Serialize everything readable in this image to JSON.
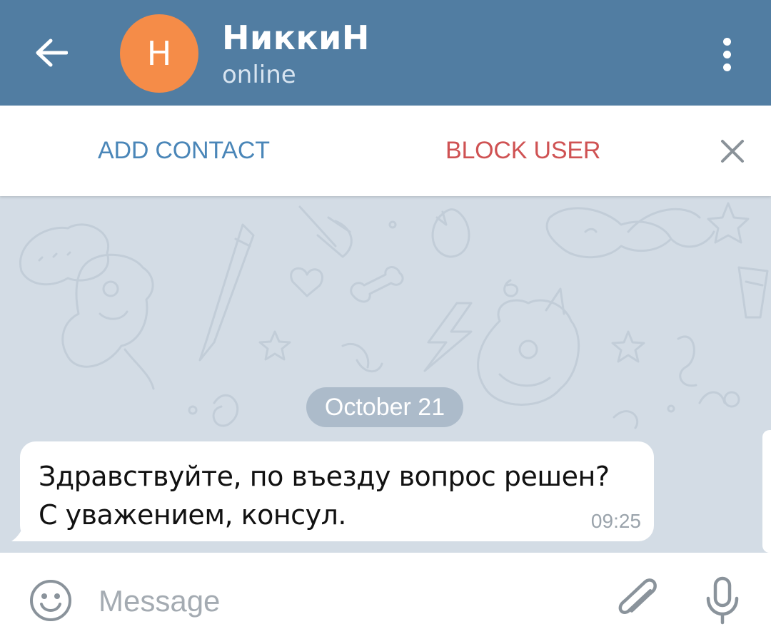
{
  "header": {
    "back_icon": "arrow-left-icon",
    "avatar_letter": "Н",
    "avatar_color": "#f58c48",
    "name": "НиккиН",
    "status": "online",
    "menu_icon": "more-vertical-icon",
    "background_color": "#517da2"
  },
  "action_bar": {
    "add_contact_label": "ADD CONTACT",
    "block_user_label": "BLOCK USER",
    "close_icon": "close-icon"
  },
  "chat": {
    "date_label": "October 21",
    "messages": [
      {
        "text": "Здравствуйте, по въезду вопрос решен? С уважением, консул.",
        "time": "09:25",
        "direction": "incoming"
      }
    ]
  },
  "input_bar": {
    "emoji_icon": "emoji-icon",
    "placeholder": "Message",
    "attach_icon": "paperclip-icon",
    "mic_icon": "microphone-icon"
  }
}
